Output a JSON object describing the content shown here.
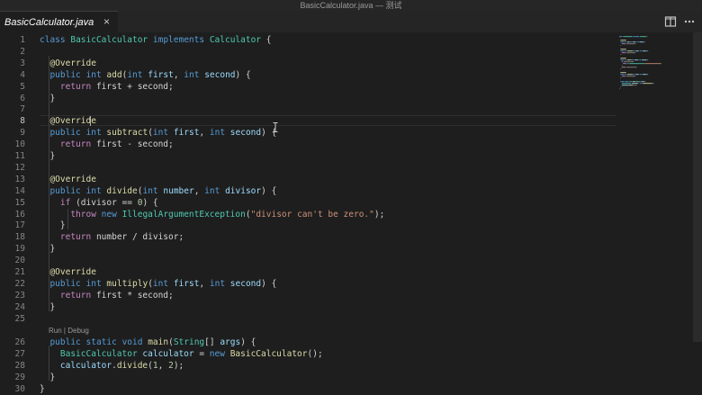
{
  "window": {
    "title": "BasicCalculator.java — 测试"
  },
  "tab": {
    "label": "BasicCalculator.java",
    "close_glyph": "×"
  },
  "icons": {
    "split": "split-editor-icon",
    "more": "more-actions-icon"
  },
  "codelens": {
    "run": "Run",
    "sep": " | ",
    "debug": "Debug"
  },
  "colors": {
    "keyword": "#569cd6",
    "control": "#c586c0",
    "type": "#4ec9b0",
    "function": "#dcdcaa",
    "variable": "#9cdcfe",
    "number": "#b5cea8",
    "string": "#ce9178",
    "background": "#1e1e1e"
  },
  "editor": {
    "active_line": "8",
    "lines": [
      {
        "n": "1",
        "t": [
          [
            "kw",
            "class"
          ],
          [
            "p",
            " "
          ],
          [
            "ty",
            "BasicCalculator"
          ],
          [
            "p",
            " "
          ],
          [
            "kw",
            "implements"
          ],
          [
            "p",
            " "
          ],
          [
            "ty",
            "Calculator"
          ],
          [
            "p",
            " {"
          ]
        ]
      },
      {
        "n": "2",
        "t": []
      },
      {
        "n": "3",
        "t": [
          [
            "p",
            "  "
          ],
          [
            "ann",
            "@Override"
          ]
        ]
      },
      {
        "n": "4",
        "t": [
          [
            "p",
            "  "
          ],
          [
            "kw",
            "public"
          ],
          [
            "p",
            " "
          ],
          [
            "kw",
            "int"
          ],
          [
            "p",
            " "
          ],
          [
            "fn",
            "add"
          ],
          [
            "p",
            "("
          ],
          [
            "kw",
            "int"
          ],
          [
            "p",
            " "
          ],
          [
            "var",
            "first"
          ],
          [
            "p",
            ", "
          ],
          [
            "kw",
            "int"
          ],
          [
            "p",
            " "
          ],
          [
            "var",
            "second"
          ],
          [
            "p",
            ") {"
          ]
        ]
      },
      {
        "n": "5",
        "t": [
          [
            "p",
            "    "
          ],
          [
            "ctl",
            "return"
          ],
          [
            "p",
            " first + second;"
          ]
        ]
      },
      {
        "n": "6",
        "t": [
          [
            "p",
            "  }"
          ]
        ]
      },
      {
        "n": "7",
        "t": []
      },
      {
        "n": "8",
        "t": [
          [
            "p",
            "  "
          ],
          [
            "ann",
            "@Override"
          ]
        ]
      },
      {
        "n": "9",
        "t": [
          [
            "p",
            "  "
          ],
          [
            "kw",
            "public"
          ],
          [
            "p",
            " "
          ],
          [
            "kw",
            "int"
          ],
          [
            "p",
            " "
          ],
          [
            "fn",
            "subtract"
          ],
          [
            "p",
            "("
          ],
          [
            "kw",
            "int"
          ],
          [
            "p",
            " "
          ],
          [
            "var",
            "first"
          ],
          [
            "p",
            ", "
          ],
          [
            "kw",
            "int"
          ],
          [
            "p",
            " "
          ],
          [
            "var",
            "second"
          ],
          [
            "p",
            ") {"
          ]
        ]
      },
      {
        "n": "10",
        "t": [
          [
            "p",
            "    "
          ],
          [
            "ctl",
            "return"
          ],
          [
            "p",
            " first - second;"
          ]
        ]
      },
      {
        "n": "11",
        "t": [
          [
            "p",
            "  }"
          ]
        ]
      },
      {
        "n": "12",
        "t": []
      },
      {
        "n": "13",
        "t": [
          [
            "p",
            "  "
          ],
          [
            "ann",
            "@Override"
          ]
        ]
      },
      {
        "n": "14",
        "t": [
          [
            "p",
            "  "
          ],
          [
            "kw",
            "public"
          ],
          [
            "p",
            " "
          ],
          [
            "kw",
            "int"
          ],
          [
            "p",
            " "
          ],
          [
            "fn",
            "divide"
          ],
          [
            "p",
            "("
          ],
          [
            "kw",
            "int"
          ],
          [
            "p",
            " "
          ],
          [
            "var",
            "number"
          ],
          [
            "p",
            ", "
          ],
          [
            "kw",
            "int"
          ],
          [
            "p",
            " "
          ],
          [
            "var",
            "divisor"
          ],
          [
            "p",
            ") {"
          ]
        ]
      },
      {
        "n": "15",
        "t": [
          [
            "p",
            "    "
          ],
          [
            "ctl",
            "if"
          ],
          [
            "p",
            " (divisor == "
          ],
          [
            "num",
            "0"
          ],
          [
            "p",
            ") {"
          ]
        ]
      },
      {
        "n": "16",
        "t": [
          [
            "p",
            "      "
          ],
          [
            "ctl",
            "throw"
          ],
          [
            "p",
            " "
          ],
          [
            "kw",
            "new"
          ],
          [
            "p",
            " "
          ],
          [
            "ty",
            "IllegalArgumentException"
          ],
          [
            "p",
            "("
          ],
          [
            "str",
            "\"divisor can't be zero.\""
          ],
          [
            "p",
            ");"
          ]
        ]
      },
      {
        "n": "17",
        "t": [
          [
            "p",
            "    }"
          ]
        ]
      },
      {
        "n": "18",
        "t": [
          [
            "p",
            "    "
          ],
          [
            "ctl",
            "return"
          ],
          [
            "p",
            " number / divisor;"
          ]
        ]
      },
      {
        "n": "19",
        "t": [
          [
            "p",
            "  }"
          ]
        ]
      },
      {
        "n": "20",
        "t": []
      },
      {
        "n": "21",
        "t": [
          [
            "p",
            "  "
          ],
          [
            "ann",
            "@Override"
          ]
        ]
      },
      {
        "n": "22",
        "t": [
          [
            "p",
            "  "
          ],
          [
            "kw",
            "public"
          ],
          [
            "p",
            " "
          ],
          [
            "kw",
            "int"
          ],
          [
            "p",
            " "
          ],
          [
            "fn",
            "multiply"
          ],
          [
            "p",
            "("
          ],
          [
            "kw",
            "int"
          ],
          [
            "p",
            " "
          ],
          [
            "var",
            "first"
          ],
          [
            "p",
            ", "
          ],
          [
            "kw",
            "int"
          ],
          [
            "p",
            " "
          ],
          [
            "var",
            "second"
          ],
          [
            "p",
            ") {"
          ]
        ]
      },
      {
        "n": "23",
        "t": [
          [
            "p",
            "    "
          ],
          [
            "ctl",
            "return"
          ],
          [
            "p",
            " first * second;"
          ]
        ]
      },
      {
        "n": "24",
        "t": [
          [
            "p",
            "  }"
          ]
        ]
      },
      {
        "n": "25",
        "t": []
      },
      {
        "n": "26",
        "t": [
          [
            "p",
            "  "
          ],
          [
            "kw",
            "public"
          ],
          [
            "p",
            " "
          ],
          [
            "kw",
            "static"
          ],
          [
            "p",
            " "
          ],
          [
            "kw",
            "void"
          ],
          [
            "p",
            " "
          ],
          [
            "fn",
            "main"
          ],
          [
            "p",
            "("
          ],
          [
            "ty",
            "String"
          ],
          [
            "p",
            "[] "
          ],
          [
            "var",
            "args"
          ],
          [
            "p",
            ") {"
          ]
        ]
      },
      {
        "n": "27",
        "t": [
          [
            "p",
            "    "
          ],
          [
            "ty",
            "BasicCalculator"
          ],
          [
            "p",
            " "
          ],
          [
            "var",
            "calculator"
          ],
          [
            "p",
            " = "
          ],
          [
            "kw",
            "new"
          ],
          [
            "p",
            " "
          ],
          [
            "fn",
            "BasicCalculator"
          ],
          [
            "p",
            "();"
          ]
        ]
      },
      {
        "n": "28",
        "t": [
          [
            "p",
            "    "
          ],
          [
            "var",
            "calculator"
          ],
          [
            "p",
            "."
          ],
          [
            "fn",
            "divide"
          ],
          [
            "p",
            "("
          ],
          [
            "num",
            "1"
          ],
          [
            "p",
            ", "
          ],
          [
            "num",
            "2"
          ],
          [
            "p",
            ");"
          ]
        ]
      },
      {
        "n": "29",
        "t": [
          [
            "p",
            "  }"
          ]
        ]
      },
      {
        "n": "30",
        "t": [
          [
            "p",
            "}"
          ]
        ]
      }
    ]
  }
}
